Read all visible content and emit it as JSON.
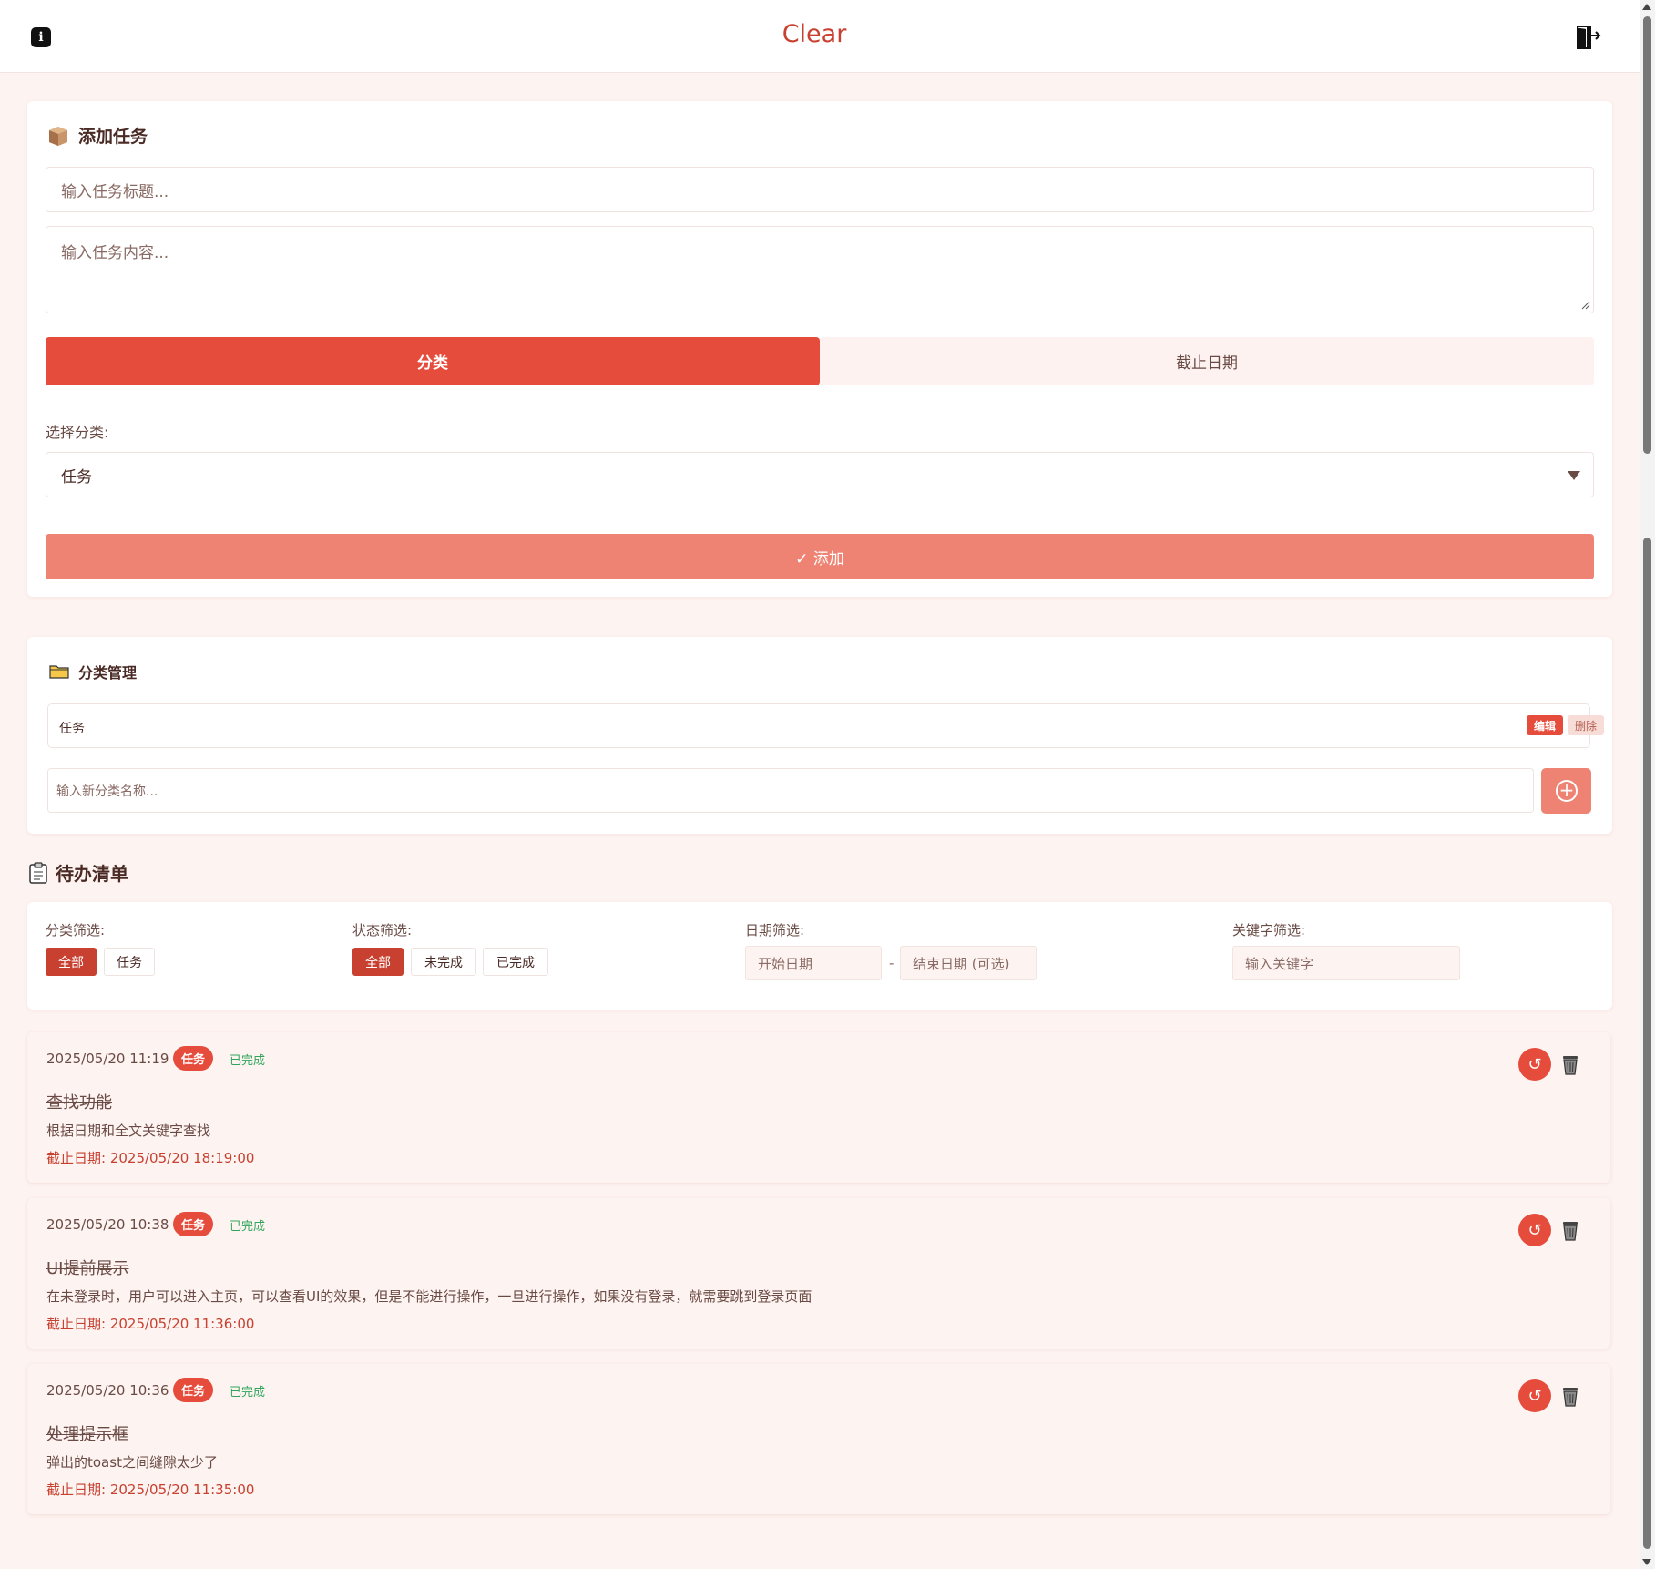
{
  "header": {
    "title": "Clear",
    "info_icon": "info-icon",
    "logout_icon": "logout-icon",
    "info_glyph": "i"
  },
  "add_task": {
    "heading": "添加任务",
    "title_placeholder": "输入任务标题...",
    "content_placeholder": "输入任务内容...",
    "tabs": [
      {
        "label": "分类",
        "active": true
      },
      {
        "label": "截止日期",
        "active": false
      }
    ],
    "select_label": "选择分类:",
    "selected_category": "任务",
    "submit_label": "✓ 添加"
  },
  "category_manage": {
    "heading": "分类管理",
    "categories": [
      {
        "name": "任务",
        "edit_label": "编辑",
        "delete_label": "删除"
      }
    ],
    "new_placeholder": "输入新分类名称...",
    "add_glyph": "+"
  },
  "todo": {
    "heading": "待办清单",
    "filters": {
      "category_label": "分类筛选:",
      "category_options": [
        "全部",
        "任务"
      ],
      "category_selected": "全部",
      "status_label": "状态筛选:",
      "status_options": [
        "全部",
        "未完成",
        "已完成"
      ],
      "status_selected": "全部",
      "date_label": "日期筛选:",
      "start_placeholder": "开始日期",
      "end_placeholder": "结束日期 (可选)",
      "date_separator": "-",
      "keyword_label": "关键字筛选:",
      "keyword_placeholder": "输入关键字"
    },
    "tasks": [
      {
        "created": "2025/05/20 11:19",
        "category": "任务",
        "status": "已完成",
        "title": "查找功能",
        "content": "根据日期和全文关键字查找",
        "deadline": "截止日期: 2025/05/20 18:19:00",
        "undo_glyph": "↺"
      },
      {
        "created": "2025/05/20 10:38",
        "category": "任务",
        "status": "已完成",
        "title": "UI提前展示",
        "content": "在未登录时，用户可以进入主页，可以查看UI的效果，但是不能进行操作，一旦进行操作，如果没有登录，就需要跳到登录页面",
        "deadline": "截止日期: 2025/05/20 11:36:00",
        "undo_glyph": "↺"
      },
      {
        "created": "2025/05/20 10:36",
        "category": "任务",
        "status": "已完成",
        "title": "处理提示框",
        "content": "弹出的toast之间缝隙太少了",
        "deadline": "截止日期: 2025/05/20 11:35:00",
        "undo_glyph": "↺"
      }
    ]
  },
  "colors": {
    "accent": "#e64c3c",
    "accent_light": "#ee8374",
    "background": "#fdf3f1",
    "done": "#2ea55a"
  }
}
